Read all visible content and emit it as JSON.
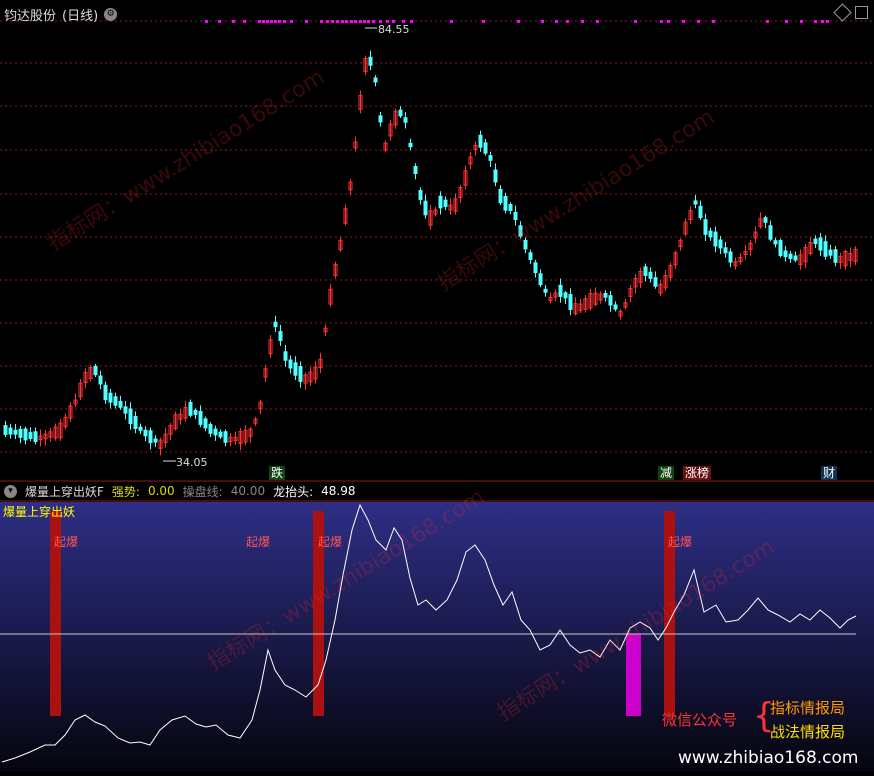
{
  "window": {
    "title": "钧达股份",
    "period": "(日线)"
  },
  "main_chart": {
    "price_high_label": "84.55",
    "price_low_label": "34.05",
    "up_color": "#ff3333",
    "down_color": "#54ffff",
    "badges": [
      "跌",
      "减",
      "涨榜",
      "财"
    ]
  },
  "indicator": {
    "name": "爆量上穿出妖F",
    "panel_label": "爆量上穿出妖",
    "fields": [
      {
        "label": "强势:",
        "value": "0.00"
      },
      {
        "label": "操盘线:",
        "value": "40.00"
      },
      {
        "label": "龙抬头:",
        "value": "48.98"
      }
    ],
    "burst_label": "起爆"
  },
  "promo": {
    "wechat": "微信公众号",
    "brand1": "指标情报局",
    "brand2": "战法情报局",
    "site": "www.zhibiao168.com"
  },
  "watermark": {
    "text": "指标网：www.zhibiao168.com"
  },
  "colors": {
    "grid": "#8b1a1a",
    "magenta": "#ff00ff",
    "burst_bar": "#aa1111",
    "ref_line": "#c8c8c8"
  }
}
